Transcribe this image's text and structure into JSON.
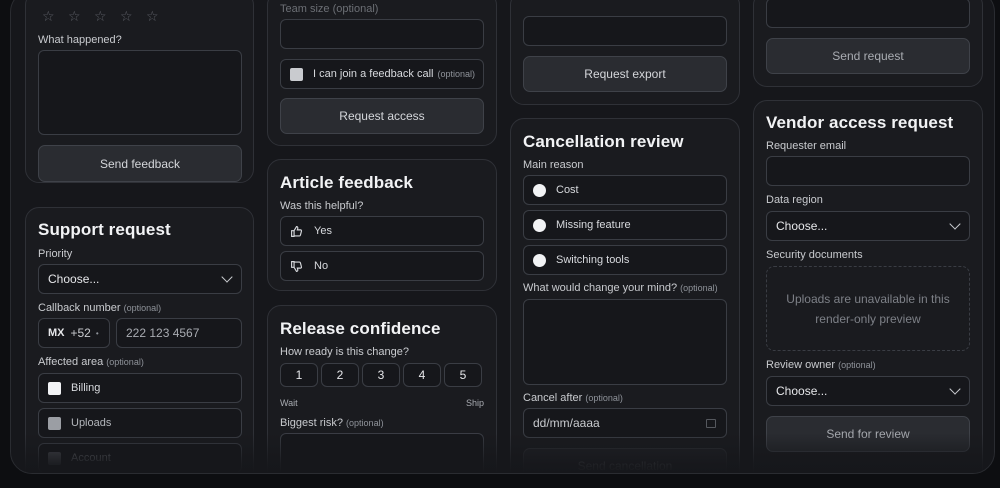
{
  "feedback": {
    "what_happened_label": "What happened?",
    "send_label": "Send feedback"
  },
  "support": {
    "title": "Support request",
    "priority_label": "Priority",
    "priority_value": "Choose...",
    "callback_label": "Callback number",
    "callback_optional": "(optional)",
    "country_code": "MX",
    "dial_code": "+52",
    "phone_placeholder": "222 123 4567",
    "affected_label": "Affected area",
    "affected_optional": "(optional)",
    "areas": [
      "Billing",
      "Uploads",
      "Account"
    ]
  },
  "access": {
    "field_label": "Team size (optional)",
    "checkbox_label": "I can join a feedback call",
    "checkbox_optional": "(optional)",
    "button_label": "Request access"
  },
  "article": {
    "title": "Article feedback",
    "question": "Was this helpful?",
    "yes": "Yes",
    "no": "No"
  },
  "release": {
    "title": "Release confidence",
    "question": "How ready is this change?",
    "scale": [
      "1",
      "2",
      "3",
      "4",
      "5"
    ],
    "low_label": "Wait",
    "high_label": "Ship",
    "risk_label": "Biggest risk?",
    "risk_optional": "(optional)"
  },
  "export": {
    "button_label": "Request export"
  },
  "cancellation": {
    "title": "Cancellation review",
    "reason_label": "Main reason",
    "reasons": [
      "Cost",
      "Missing feature",
      "Switching tools"
    ],
    "change_label": "What would change your mind?",
    "change_optional": "(optional)",
    "cancel_after_label": "Cancel after",
    "cancel_after_optional": "(optional)",
    "date_placeholder": "dd/mm/aaaa",
    "send_label": "Send cancellation"
  },
  "top_right": {
    "button_label": "Send request"
  },
  "vendor": {
    "title": "Vendor access request",
    "email_label": "Requester email",
    "region_label": "Data region",
    "region_value": "Choose...",
    "docs_label": "Security documents",
    "docs_note": "Uploads are unavailable in this render-only preview",
    "owner_label": "Review owner",
    "owner_optional": "(optional)",
    "owner_value": "Choose...",
    "send_label": "Send for review"
  }
}
